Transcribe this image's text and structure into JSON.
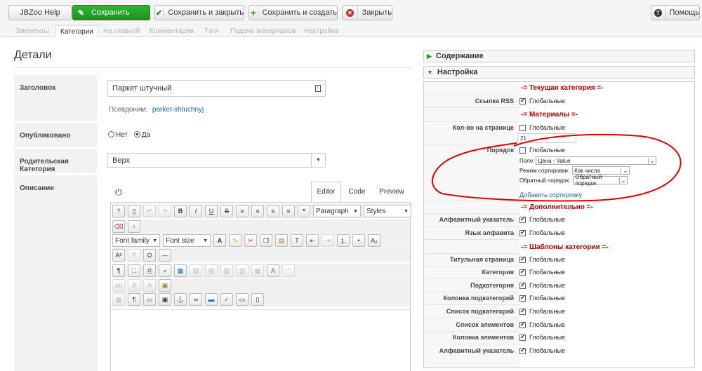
{
  "toolbar": {
    "jbzoo_help": "JBZoo Help",
    "save": "Сохранить",
    "save_close": "Сохранить и закрыть",
    "save_new": "Сохранить и создать",
    "close": "Закрыть",
    "help": "Помощь"
  },
  "tabs": [
    "Элементы",
    "Категории",
    "На главной",
    "Комментарии",
    "Тэги",
    "Подачи материалов",
    "Настройка"
  ],
  "details": {
    "title": "Детали",
    "title_label": "Заголовок",
    "title_value": "Паркет штучный",
    "alias_label": "Псевдоним:",
    "alias_value": "parket-shtuchnyj",
    "published_label": "Опубликовано",
    "published_no": "Нет",
    "published_yes": "Да",
    "parent_label": "Родительская Категория",
    "parent_value": "Верх",
    "description_label": "Описание"
  },
  "editor": {
    "tabs": [
      "Editor",
      "Code",
      "Preview"
    ],
    "paragraph": "Paragraph",
    "styles": "Styles",
    "font_family": "Font family",
    "font_size": "Font size"
  },
  "panels": {
    "content": "Содержание",
    "settings": "Настройка"
  },
  "settings": {
    "global": "Глобальные",
    "sec_current": "-= Текущая категория =-",
    "rss": "Ссылка RSS",
    "sec_items": "-= Материалы =-",
    "per_page": "Кол-во на странице",
    "per_page_value": "21",
    "order": "Порядок",
    "field_label": "Поле:",
    "field_value": "Цена - Value",
    "sort_mode_label": "Режим сортировки:",
    "sort_mode_value": "Как числа",
    "reverse_label": "Обратный порядок:",
    "reverse_value": "Обратный порядок",
    "add_sort": "Добавить сортировку",
    "sec_extra": "-= Дополнительно =-",
    "alpha_index": "Алфавитный указатель",
    "alpha_lang": "Язык алфавита",
    "sec_templates": "-= Шаблоны категории =-",
    "title_page": "Титульная страница",
    "category": "Категория",
    "subcategory": "Подкатегория",
    "sub_column": "Колонка подкатегорий",
    "sub_list": "Список подкатегорий",
    "items_list": "Список элементов",
    "items_column": "Колонка элементов",
    "alpha_index2": "Алфавитный указатель"
  }
}
